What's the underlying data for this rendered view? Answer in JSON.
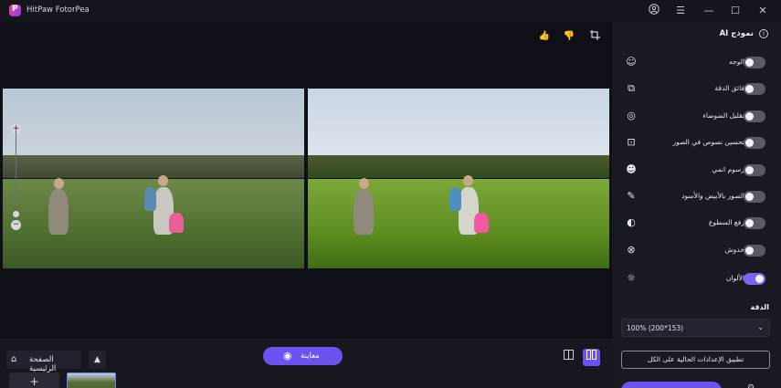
{
  "app": {
    "title": "HitPaw FotorPea"
  },
  "titlebar": {
    "icons": [
      "account-icon",
      "menu-icon",
      "minimize-icon",
      "maximize-icon",
      "close-icon"
    ]
  },
  "toolbar": {
    "icons": [
      "thumbs-up-icon",
      "thumbs-down-icon",
      "crop-icon"
    ]
  },
  "zoom": {
    "plus": "+",
    "minus": "−"
  },
  "bottom": {
    "home_label": "الصفحة الرئيسية",
    "preview_label": "معاينة",
    "add_thumb": "+"
  },
  "panel": {
    "title": "نموذج AI",
    "features": [
      {
        "label": "الوجه",
        "icon": "face-icon",
        "on": false
      },
      {
        "label": "فائق الدقة",
        "icon": "super-resolution-icon",
        "on": false
      },
      {
        "label": "تقليل الضوضاء",
        "icon": "denoise-icon",
        "on": false
      },
      {
        "label": "تحسين نصوص في الصور",
        "icon": "text-enhance-icon",
        "on": false
      },
      {
        "label": "رسوم انمي",
        "icon": "anime-icon",
        "on": false
      },
      {
        "label": "الصور بالأبيض والأسود",
        "icon": "black-white-icon",
        "on": false
      },
      {
        "label": "رفع السطوع",
        "icon": "brightness-icon",
        "on": false
      },
      {
        "label": "خدوش",
        "icon": "scratch-icon",
        "on": false
      },
      {
        "label": "الألوان",
        "icon": "colors-icon",
        "on": true
      }
    ],
    "resolution_title": "الدقة",
    "resolution_value": "100% (200*153)",
    "apply_label": "تطبيق الإعدادات الحالية على الكل"
  },
  "colors": {
    "accent": "#6a53f0",
    "toggle_on": "#7b63f5",
    "toggle_off": "#5a5a66"
  }
}
